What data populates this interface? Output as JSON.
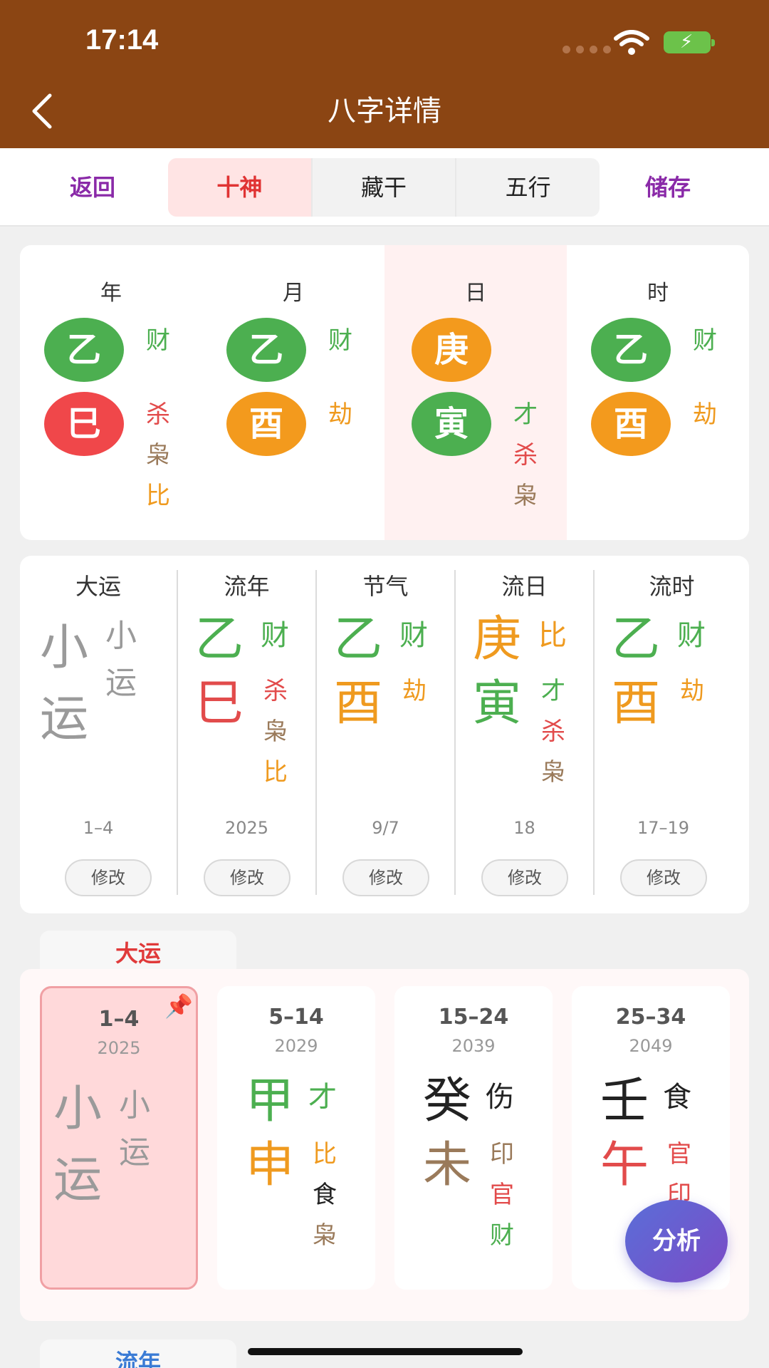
{
  "status_bar": {
    "time": "17:14"
  },
  "nav": {
    "title": "八字详情"
  },
  "toolbar": {
    "back_label": "返回",
    "save_label": "储存",
    "tabs": [
      "十神",
      "藏干",
      "五行"
    ]
  },
  "colors": {
    "header": "#8b4513",
    "wood": "#4caf50",
    "fire": "#e24b4b",
    "metal": "#ef9a1f",
    "earth": "#9a7a5a",
    "water": "#222222"
  },
  "pillars": [
    {
      "head": "年",
      "stem": "乙",
      "stem_god": "财",
      "branch": "巳",
      "branch_gods": [
        "杀",
        "枭",
        "比"
      ]
    },
    {
      "head": "月",
      "stem": "乙",
      "stem_god": "财",
      "branch": "酉",
      "branch_gods": [
        "劫"
      ]
    },
    {
      "head": "日",
      "stem": "庚",
      "stem_god": "",
      "branch": "寅",
      "branch_gods": [
        "才",
        "杀",
        "枭"
      ]
    },
    {
      "head": "时",
      "stem": "乙",
      "stem_god": "财",
      "branch": "酉",
      "branch_gods": [
        "劫"
      ]
    }
  ],
  "fortune": {
    "edit_label": "修改",
    "columns": [
      {
        "head": "大运",
        "stem": "小",
        "branch": "运",
        "side_top": "小",
        "side_bottom": [
          "运"
        ],
        "meta": "1–4"
      },
      {
        "head": "流年",
        "stem": "乙",
        "stem_god": "财",
        "branch": "巳",
        "branch_gods": [
          "杀",
          "枭",
          "比"
        ],
        "meta": "2025"
      },
      {
        "head": "节气",
        "stem": "乙",
        "stem_god": "财",
        "branch": "酉",
        "branch_gods": [
          "劫"
        ],
        "meta": "9/7"
      },
      {
        "head": "流日",
        "stem": "庚",
        "stem_god": "比",
        "branch": "寅",
        "branch_gods": [
          "才",
          "杀",
          "枭"
        ],
        "meta": "18"
      },
      {
        "head": "流时",
        "stem": "乙",
        "stem_god": "财",
        "branch": "酉",
        "branch_gods": [
          "劫"
        ],
        "meta": "17–19"
      }
    ]
  },
  "dayun": {
    "tab_label": "大运",
    "cards": [
      {
        "range": "1–4",
        "year": "2025",
        "stem": "小",
        "branch": "运",
        "stem_god": "小",
        "branch_gods": [
          "运"
        ]
      },
      {
        "range": "5–14",
        "year": "2029",
        "stem": "甲",
        "stem_god": "才",
        "branch": "申",
        "branch_gods": [
          "比",
          "食",
          "枭"
        ]
      },
      {
        "range": "15–24",
        "year": "2039",
        "stem": "癸",
        "stem_god": "伤",
        "branch": "未",
        "branch_gods": [
          "印",
          "官",
          "财"
        ]
      },
      {
        "range": "25–34",
        "year": "2049",
        "stem": "壬",
        "stem_god": "食",
        "branch": "午",
        "branch_gods": [
          "官",
          "印"
        ]
      }
    ]
  },
  "liunian": {
    "tab_label": "流年"
  },
  "fab": {
    "label": "分析"
  }
}
